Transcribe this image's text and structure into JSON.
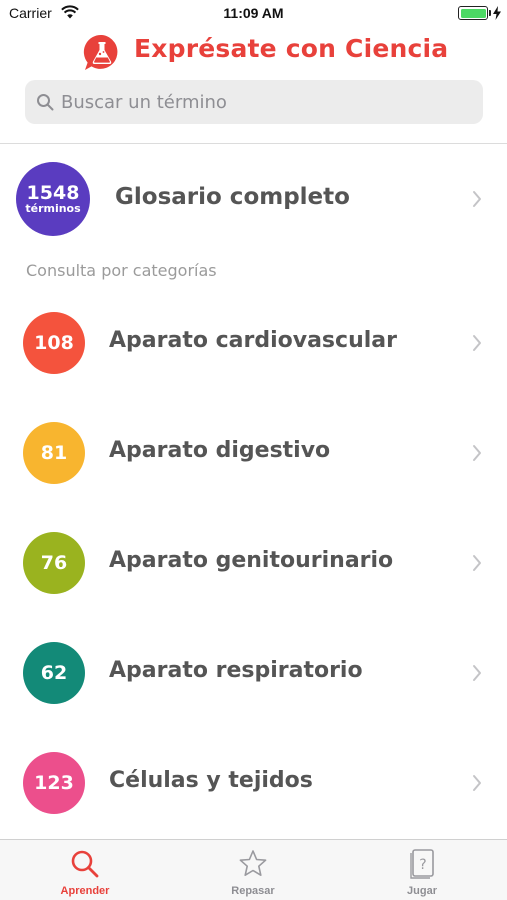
{
  "status_bar": {
    "carrier": "Carrier",
    "time": "11:09 AM"
  },
  "header": {
    "title": "Exprésate con Ciencia",
    "logo_icon": "flask-bubble-icon",
    "brand_color": "#e8413b"
  },
  "search": {
    "placeholder": "Buscar un término",
    "value": ""
  },
  "glossary": {
    "count": "1548",
    "unit": "términos",
    "label": "Glosario completo",
    "color": "#5a3cc0"
  },
  "section_heading": "Consulta por categorías",
  "categories": [
    {
      "count": "108",
      "label": "Aparato cardiovascular",
      "color": "#f4533d"
    },
    {
      "count": "81",
      "label": "Aparato digestivo",
      "color": "#f8b52f"
    },
    {
      "count": "76",
      "label": "Aparato genitourinario",
      "color": "#9ab31f"
    },
    {
      "count": "62",
      "label": "Aparato respiratorio",
      "color": "#138a78"
    },
    {
      "count": "123",
      "label": "Células y tejidos",
      "color": "#ec4f8c"
    }
  ],
  "tabs": [
    {
      "label": "Aprender",
      "icon": "search-icon",
      "active": true
    },
    {
      "label": "Repasar",
      "icon": "star-icon",
      "active": false
    },
    {
      "label": "Jugar",
      "icon": "question-card-icon",
      "active": false
    }
  ]
}
